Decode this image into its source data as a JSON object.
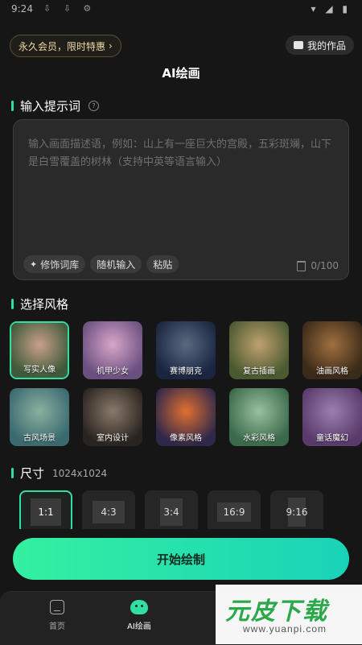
{
  "status_bar": {
    "time": "9:24"
  },
  "header": {
    "vip_label": "永久会员，限时特惠",
    "vip_chevron": "›",
    "works_label": "我的作品",
    "title": "AI绘画"
  },
  "prompt": {
    "section_title": "输入提示词",
    "help_glyph": "?",
    "placeholder": "输入画面描述语，例如：山上有一座巨大的宫殿，五彩斑斓，山下是白雪覆盖的树林（支持中英等语言输入）",
    "chips": [
      "修饰词库",
      "随机输入",
      "粘贴"
    ],
    "counter": "0/100"
  },
  "styles": {
    "section_title": "选择风格",
    "items": [
      {
        "label": "写实人像",
        "selected": true,
        "colors": [
          "#3f5a3a",
          "#c9a08a"
        ]
      },
      {
        "label": "机甲少女",
        "selected": false,
        "colors": [
          "#6a5080",
          "#d9a6c9"
        ]
      },
      {
        "label": "赛博朋克",
        "selected": false,
        "colors": [
          "#1a2540",
          "#5a6a80"
        ]
      },
      {
        "label": "复古插画",
        "selected": false,
        "colors": [
          "#4a5a30",
          "#c0a070"
        ]
      },
      {
        "label": "油画风格",
        "selected": false,
        "colors": [
          "#3a2a18",
          "#a07040"
        ]
      },
      {
        "label": "古风场景",
        "selected": false,
        "colors": [
          "#3a6a70",
          "#8ab0a0"
        ]
      },
      {
        "label": "室内设计",
        "selected": false,
        "colors": [
          "#2a2420",
          "#8a7a6a"
        ]
      },
      {
        "label": "像素风格",
        "selected": false,
        "colors": [
          "#30284a",
          "#e07030"
        ]
      },
      {
        "label": "水彩风格",
        "selected": false,
        "colors": [
          "#3a6a4a",
          "#9ac0a0"
        ]
      },
      {
        "label": "童话魔幻",
        "selected": false,
        "colors": [
          "#5a3a6a",
          "#9a80b0"
        ]
      }
    ]
  },
  "size": {
    "section_title": "尺寸",
    "current": "1024x1024",
    "options": [
      {
        "label": "1:1",
        "selected": true
      },
      {
        "label": "4:3",
        "selected": false
      },
      {
        "label": "3:4",
        "selected": false
      },
      {
        "label": "16:9",
        "selected": false
      },
      {
        "label": "9:16",
        "selected": false
      }
    ]
  },
  "cta": {
    "label": "开始绘制"
  },
  "tabs": [
    {
      "label": "首页",
      "active": false
    },
    {
      "label": "AI绘画",
      "active": true
    }
  ],
  "watermark": {
    "main": "元皮下载",
    "sub": "www.yuanpi.com"
  }
}
